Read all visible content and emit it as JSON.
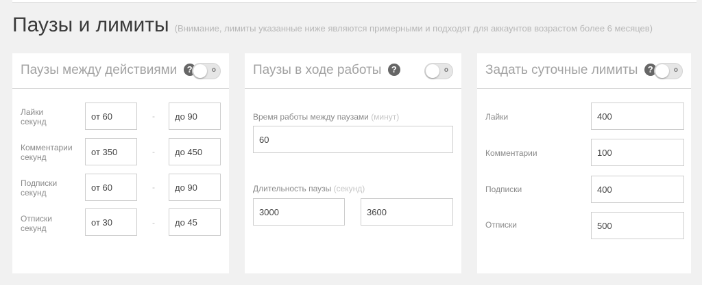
{
  "page": {
    "title": "Паузы и лимиты",
    "note": "(Внимание, лимиты указанные ниже являются примерными и подходят для аккаунтов возрастом более 6 месяцев)"
  },
  "help_glyph": "?",
  "toggle_off_label": "o",
  "panels": {
    "action_pauses": {
      "title": "Паузы между действиями",
      "enabled": false,
      "separator": "-",
      "rows": [
        {
          "label_line1": "Лайки",
          "label_line2": "секунд",
          "from": "от 60",
          "to": "до 90"
        },
        {
          "label_line1": "Комментарии",
          "label_line2": "секунд",
          "from": "от 350",
          "to": "до 450"
        },
        {
          "label_line1": "Подписки",
          "label_line2": "секунд",
          "from": "от 60",
          "to": "до 90"
        },
        {
          "label_line1": "Отписки",
          "label_line2": "секунд",
          "from": "от 30",
          "to": "до 45"
        }
      ]
    },
    "work_pauses": {
      "title": "Паузы в ходе работы",
      "enabled": false,
      "work_time_label": "Время работы между паузами",
      "work_time_unit": "(минут)",
      "work_time_value": "60",
      "pause_length_label": "Длительность паузы",
      "pause_length_unit": "(секунд)",
      "pause_from": "3000",
      "pause_to": "3600"
    },
    "daily_limits": {
      "title": "Задать суточные лимиты",
      "enabled": false,
      "rows": [
        {
          "label": "Лайки",
          "value": "400"
        },
        {
          "label": "Комментарии",
          "value": "100"
        },
        {
          "label": "Подписки",
          "value": "400"
        },
        {
          "label": "Отписки",
          "value": "500"
        }
      ]
    }
  }
}
